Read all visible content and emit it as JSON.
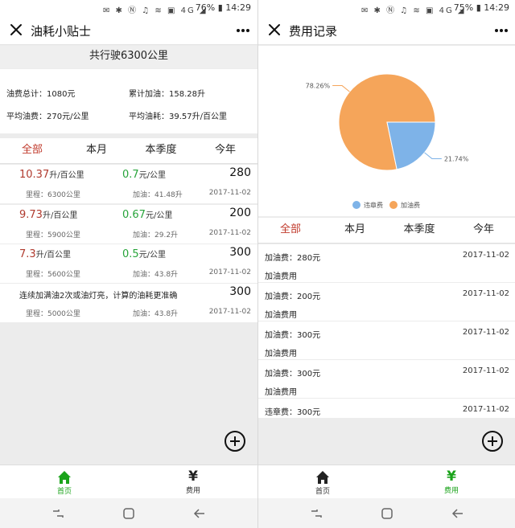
{
  "status_left": {
    "battery": "76%",
    "time": "14:29",
    "net": "4G"
  },
  "status_right": {
    "battery": "75%",
    "time": "14:29",
    "net": "4G"
  },
  "colors": {
    "active_tab": "#c0392b",
    "green": "#27a43a",
    "pie_orange": "#f5a55a",
    "pie_blue": "#7eb3e8"
  },
  "icons": {
    "close": "close-icon",
    "more": "more-icon",
    "home": "home-icon",
    "yen": "yen-icon",
    "plus": "plus-icon"
  },
  "left": {
    "title": "油耗小贴士",
    "summary": "共行驶6300公里",
    "stats": {
      "fuel_total": "油费总计：1080元",
      "refuel_total": "累计加油：158.28升",
      "avg_cost": "平均油费：270元/公里",
      "avg_consumption": "平均油耗：39.57升/百公里"
    },
    "tabs": [
      "全部",
      "本月",
      "本季度",
      "今年"
    ],
    "records": [
      {
        "consumption": "10.37",
        "cons_unit": "升/百公里",
        "cost": "0.7",
        "cost_unit": "元/公里",
        "amount": "280",
        "mileage": "里程：6300公里",
        "fuel": "加油：41.48升",
        "date": "2017-11-02"
      },
      {
        "consumption": "9.73",
        "cons_unit": "升/百公里",
        "cost": "0.67",
        "cost_unit": "元/公里",
        "amount": "200",
        "mileage": "里程：5900公里",
        "fuel": "加油：29.2升",
        "date": "2017-11-02"
      },
      {
        "consumption": "7.3",
        "cons_unit": "升/百公里",
        "cost": "0.5",
        "cost_unit": "元/公里",
        "amount": "300",
        "mileage": "里程：5600公里",
        "fuel": "加油：43.8升",
        "date": "2017-11-02"
      }
    ],
    "note_record": {
      "note": "连续加满油2次或油灯亮，计算的油耗更准确",
      "amount": "300",
      "mileage": "里程：5000公里",
      "fuel": "加油：43.8升",
      "date": "2017-11-02"
    }
  },
  "right": {
    "title": "费用记录",
    "chart_data": {
      "type": "pie",
      "labels": [
        "加油费",
        "违章费"
      ],
      "values": [
        78.26,
        21.74
      ],
      "value_labels": [
        "78.26%",
        "21.74%"
      ],
      "colors": [
        "#f5a55a",
        "#7eb3e8"
      ],
      "legend": [
        "违章费",
        "加油费"
      ],
      "legend_placement": "bottom"
    },
    "tabs": [
      "全部",
      "本月",
      "本季度",
      "今年"
    ],
    "rows": [
      {
        "amount": "加油费：280元",
        "date": "2017-11-02",
        "type": "加油费用"
      },
      {
        "amount": "加油费：200元",
        "date": "2017-11-02",
        "type": "加油费用"
      },
      {
        "amount": "加油费：300元",
        "date": "2017-11-02",
        "type": "加油费用"
      },
      {
        "amount": "加油费：300元",
        "date": "2017-11-02",
        "type": "加油费用"
      },
      {
        "amount": "违章费：300元",
        "date": "2017-11-02",
        "type": ""
      }
    ]
  },
  "bottom_tabs": [
    {
      "label": "首页"
    },
    {
      "label": "费用"
    }
  ]
}
